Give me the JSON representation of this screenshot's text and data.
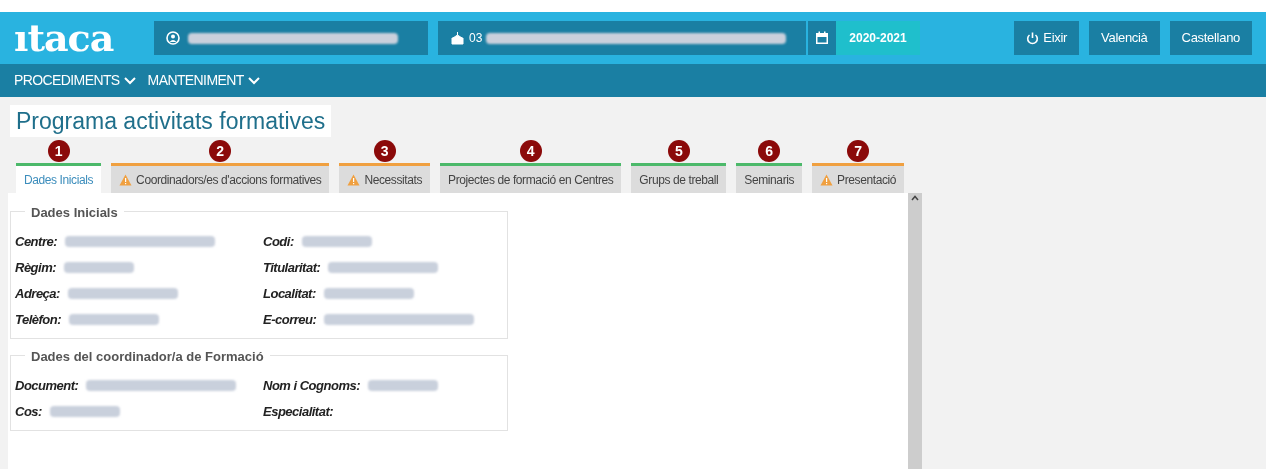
{
  "header": {
    "logo": "ıtaca",
    "school_code_prefix": "03",
    "year": "2020-2021",
    "buttons": [
      {
        "kind": "logout",
        "label": "Eixir"
      },
      {
        "kind": "lang",
        "label": "Valencià"
      },
      {
        "kind": "lang",
        "label": "Castellano"
      }
    ]
  },
  "menu": [
    {
      "label": "PROCEDIMENTS"
    },
    {
      "label": "MANTENIMENT"
    }
  ],
  "page_title": "Programa activitats formatives",
  "tabs": [
    {
      "number": "1",
      "label": "Dades Inicials",
      "warning": false,
      "selected": true
    },
    {
      "number": "2",
      "label": "Coordinadors/es d'accions formatives",
      "warning": true,
      "selected": false
    },
    {
      "number": "3",
      "label": "Necessitats",
      "warning": true,
      "selected": false
    },
    {
      "number": "4",
      "label": "Projectes de formació en Centres",
      "warning": false,
      "selected": false
    },
    {
      "number": "5",
      "label": "Grups de treball",
      "warning": false,
      "selected": false
    },
    {
      "number": "6",
      "label": "Seminaris",
      "warning": false,
      "selected": false
    },
    {
      "number": "7",
      "label": "Presentació",
      "warning": true,
      "selected": false
    }
  ],
  "sections": [
    {
      "title": "Dades Inicials",
      "left": [
        {
          "label": "Centre:",
          "filled": true
        },
        {
          "label": "Règim:",
          "filled": true
        },
        {
          "label": "Adreça:",
          "filled": true
        },
        {
          "label": "Telèfon:",
          "filled": true
        }
      ],
      "right": [
        {
          "label": "Codi:",
          "filled": true
        },
        {
          "label": "Titularitat:",
          "filled": true
        },
        {
          "label": "Localitat:",
          "filled": true
        },
        {
          "label": "E-correu:",
          "filled": true
        }
      ]
    },
    {
      "title": "Dades del coordinador/a de Formació",
      "left": [
        {
          "label": "Document:",
          "filled": true
        },
        {
          "label": "Cos:",
          "filled": true
        }
      ],
      "right": [
        {
          "label": "Nom i Cognoms:",
          "filled": true
        },
        {
          "label": "Especialitat:",
          "filled": false
        }
      ]
    }
  ]
}
